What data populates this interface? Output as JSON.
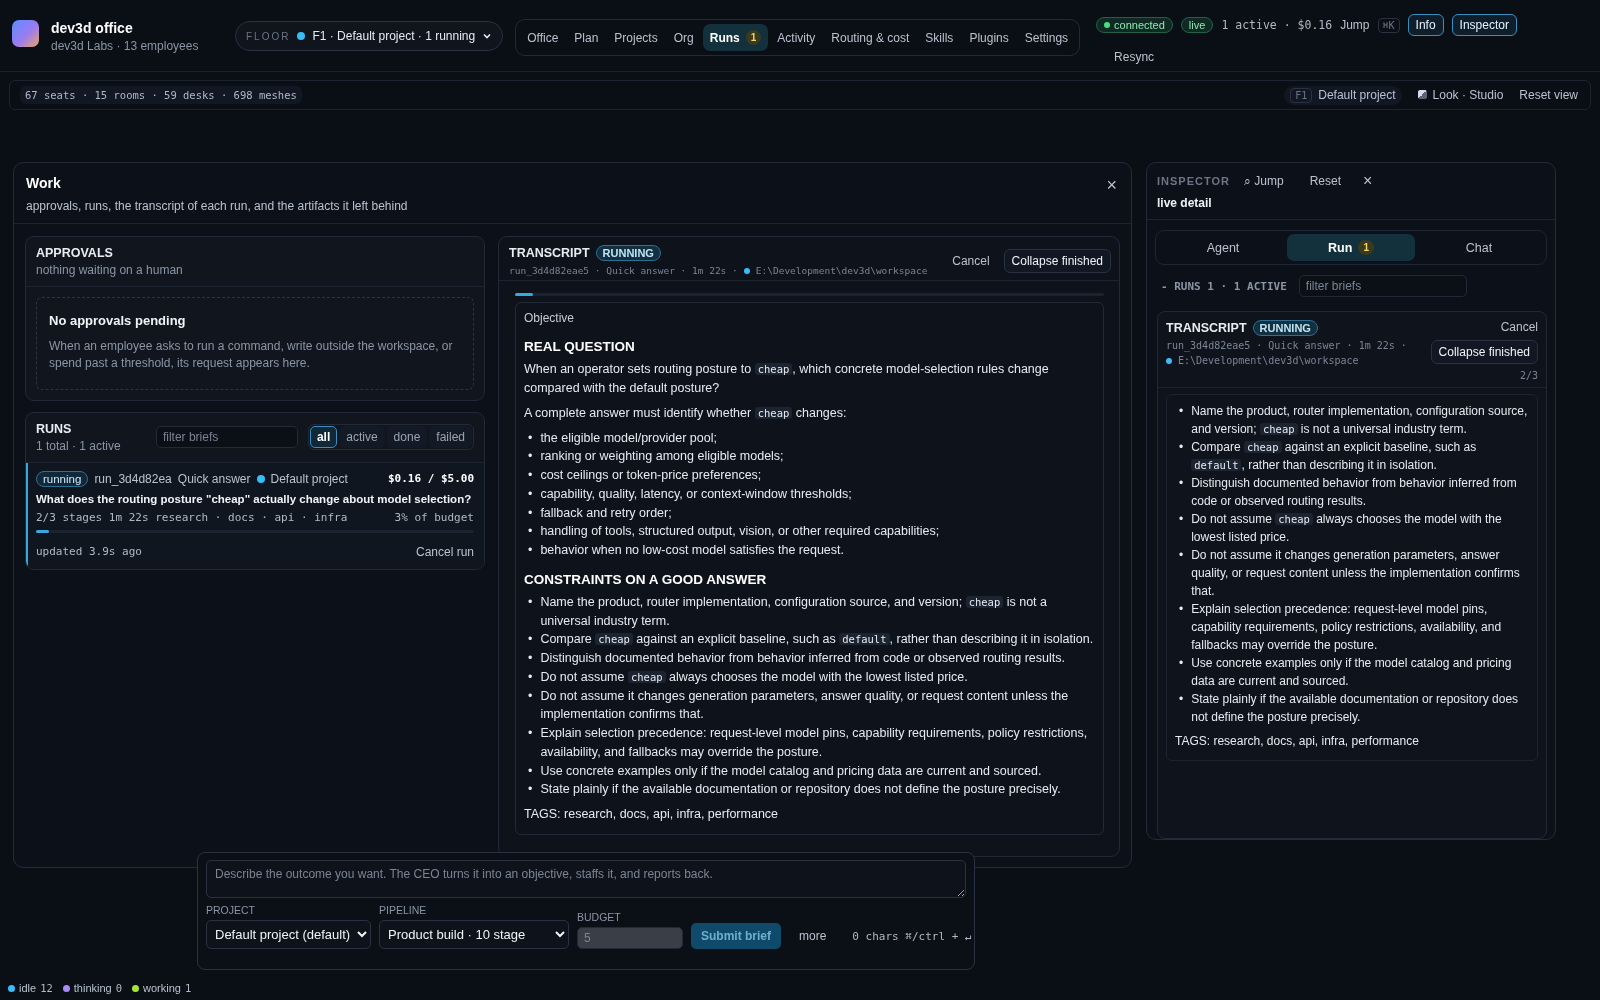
{
  "app": {
    "title": "dev3d office",
    "subtitle": "dev3d Labs · 13 employees"
  },
  "floor": {
    "label": "FLOOR",
    "value": "F1 · Default project · 1 running"
  },
  "nav": [
    {
      "label": "Office",
      "selected": false
    },
    {
      "label": "Plan",
      "selected": false
    },
    {
      "label": "Projects",
      "selected": false
    },
    {
      "label": "Org",
      "selected": false
    },
    {
      "label": "Runs",
      "selected": true,
      "badge": "1"
    },
    {
      "label": "Activity",
      "selected": false
    },
    {
      "label": "Routing & cost",
      "selected": false
    },
    {
      "label": "Skills",
      "selected": false
    },
    {
      "label": "Plugins",
      "selected": false
    },
    {
      "label": "Settings",
      "selected": false
    }
  ],
  "status": {
    "connection": "connected",
    "live": "live",
    "summary": "1 active · $0.16",
    "jump": "Jump",
    "shortcut": "⌘K",
    "buttons": [
      "Info",
      "Inspector"
    ],
    "resync": "Resync"
  },
  "scene_bar": {
    "stats": "67 seats · 15 rooms · 59 desks · 698 meshes",
    "floor_key": "F1",
    "project": "Default project",
    "look": "Look · Studio",
    "reset": "Reset view"
  },
  "work": {
    "title": "Work",
    "subtitle": "approvals, runs, the transcript of each run, and the artifacts it left behind",
    "close": "×"
  },
  "approvals": {
    "title": "APPROVALS",
    "subtitle": "nothing waiting on a human",
    "empty_title": "No approvals pending",
    "empty_text": "When an employee asks to run a command, write outside the workspace, or spend past a threshold, its request appears here."
  },
  "runs": {
    "title": "RUNS",
    "subtitle": "1 total · 1 active",
    "filter_placeholder": "filter briefs",
    "filters": [
      {
        "label": "all",
        "selected": true
      },
      {
        "label": "active",
        "selected": false
      },
      {
        "label": "done",
        "selected": false
      },
      {
        "label": "failed",
        "selected": false
      }
    ],
    "items": [
      {
        "status": "running",
        "id": "run_3d4d82ea",
        "pipeline": "Quick answer",
        "project": "Default project",
        "cost": "$0.16 / $5.00",
        "brief": "What does the routing posture \"cheap\" actually change about model selection?",
        "meta": "2/3 stages 1m 22s research · docs · api · infra",
        "budget": "3% of budget",
        "level": 0.03,
        "updated": "updated 3.9s ago",
        "cancel": "Cancel run"
      }
    ]
  },
  "transcript": {
    "title": "TRANSCRIPT",
    "status": "RUNNING",
    "meta": "run_3d4d82eae5 · Quick answer · 1m 22s ·",
    "path": "E:\\Development\\dev3d\\workspace",
    "cancel": "Cancel",
    "collapse": "Collapse finished",
    "level": 0.03,
    "bullet": "•",
    "objective_label": "Objective",
    "sections": [
      {
        "heading": "REAL QUESTION",
        "paragraphs": [
          [
            "When an operator sets routing posture to ",
            {
              "code": "cheap"
            },
            ", which concrete model-selection rules change compared with the default posture?"
          ],
          [
            "A complete answer must identify whether ",
            {
              "code": "cheap"
            },
            " changes:"
          ]
        ],
        "items": [
          [
            "the eligible model/provider pool;"
          ],
          [
            "ranking or weighting among eligible models;"
          ],
          [
            "cost ceilings or token-price preferences;"
          ],
          [
            "capability, quality, latency, or context-window thresholds;"
          ],
          [
            "fallback and retry order;"
          ],
          [
            "handling of tools, structured output, vision, or other required capabilities;"
          ],
          [
            "behavior when no low-cost model satisfies the request."
          ]
        ]
      },
      {
        "heading": "CONSTRAINTS ON A GOOD ANSWER",
        "items": [
          [
            "Name the product, router implementation, configuration source, and version; ",
            {
              "code": "cheap"
            },
            " is not a universal industry term."
          ],
          [
            "Compare ",
            {
              "code": "cheap"
            },
            " against an explicit baseline, such as ",
            {
              "code": "default"
            },
            ", rather than describing it in isolation."
          ],
          [
            "Distinguish documented behavior from behavior inferred from code or observed routing results."
          ],
          [
            "Do not assume ",
            {
              "code": "cheap"
            },
            " always chooses the model with the lowest listed price."
          ],
          [
            "Do not assume it changes generation parameters, answer quality, or request content unless the implementation confirms that."
          ],
          [
            "Explain selection precedence: request-level model pins, capability requirements, policy restrictions, availability, and fallbacks may override the posture."
          ],
          [
            "Use concrete examples only if the model catalog and pricing data are current and sourced."
          ],
          [
            "State plainly if the available documentation or repository does not define the posture precisely."
          ]
        ]
      }
    ],
    "tags": "TAGS: research, docs, api, infra, performance"
  },
  "inspector": {
    "title": "INSPECTOR",
    "subtitle": "live detail",
    "jump": "⌕ Jump",
    "reset": "Reset",
    "close": "×",
    "tabs": [
      {
        "label": "Agent",
        "selected": false
      },
      {
        "label": "Run",
        "selected": true,
        "badge": "1"
      },
      {
        "label": "Chat",
        "selected": false
      }
    ],
    "runs_label": "- RUNS 1 · 1 ACTIVE",
    "filter_placeholder": "filter briefs",
    "transcript": {
      "title": "TRANSCRIPT",
      "status": "RUNNING",
      "meta": "run_3d4d82eae5 · Quick answer · 1m 22s ·",
      "path": "E:\\Development\\dev3d\\workspace",
      "stages": "2/3",
      "cancel": "Cancel",
      "collapse": "Collapse finished",
      "bullet": "•",
      "items": [
        [
          "Name the product, router implementation, configuration source, and version; ",
          {
            "code": "cheap"
          },
          " is not a universal industry term."
        ],
        [
          "Compare ",
          {
            "code": "cheap"
          },
          " against an explicit baseline, such as ",
          {
            "code": "default"
          },
          ", rather than describing it in isolation."
        ],
        [
          "Distinguish documented behavior from behavior inferred from code or observed routing results."
        ],
        [
          "Do not assume ",
          {
            "code": "cheap"
          },
          " always chooses the model with the lowest listed price."
        ],
        [
          "Do not assume it changes generation parameters, answer quality, or request content unless the implementation confirms that."
        ],
        [
          "Explain selection precedence: request-level model pins, capability requirements, policy restrictions, availability, and fallbacks may override the posture."
        ],
        [
          "Use concrete examples only if the model catalog and pricing data are current and sourced."
        ],
        [
          "State plainly if the available documentation or repository does not define the posture precisely."
        ]
      ],
      "tags": "TAGS: research, docs, api, infra, performance"
    }
  },
  "composer": {
    "placeholder": "Describe the outcome you want. The CEO turns it into an objective, staffs it, and reports back.",
    "project_label": "PROJECT",
    "project": "Default project (default)",
    "pipeline_label": "PIPELINE",
    "pipeline": "Product build · 10 stage",
    "budget_label": "BUDGET",
    "budget_placeholder": "5",
    "submit": "Submit brief",
    "more": "more",
    "chars": "0 chars ⌘/ctrl + ↵"
  },
  "legend": [
    {
      "label": "idle",
      "count": "12",
      "color": "#38bdf8"
    },
    {
      "label": "thinking",
      "count": "0",
      "color": "#a78bfa"
    },
    {
      "label": "working",
      "count": "1",
      "color": "#a3e635"
    }
  ]
}
